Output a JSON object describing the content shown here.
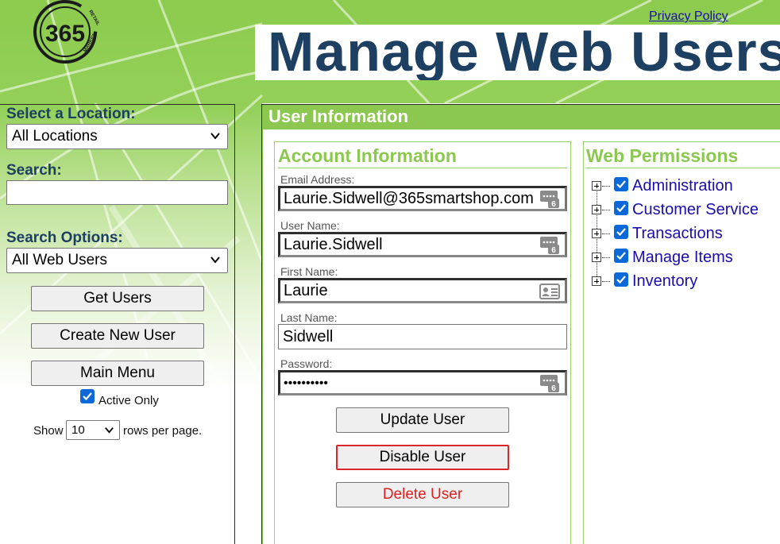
{
  "header": {
    "logo_text": "365",
    "logo_ring_top": "RETAIL",
    "logo_ring_bottom": "MARKETS",
    "privacy_link": "Privacy Policy",
    "page_title": "Manage Web Users"
  },
  "sidebar": {
    "location_label": "Select a Location:",
    "location_value": "All Locations",
    "search_label": "Search:",
    "search_value": "",
    "options_label": "Search Options:",
    "options_value": "All Web Users",
    "get_users": "Get Users",
    "create_user": "Create New User",
    "main_menu": "Main Menu",
    "active_only": "Active Only",
    "active_only_checked": true,
    "show_label": "Show",
    "rows_value": "10",
    "rows_suffix": "rows per page."
  },
  "main": {
    "header": "User Information",
    "account": {
      "title": "Account Information",
      "email_label": "Email Address:",
      "email_value": "Laurie.Sidwell@365smartshop.com",
      "username_label": "User Name:",
      "username_value": "Laurie.Sidwell",
      "firstname_label": "First Name:",
      "firstname_value": "Laurie",
      "lastname_label": "Last Name:",
      "lastname_value": "Sidwell",
      "password_label": "Password:",
      "password_value": "••••••••••",
      "update_button": "Update User",
      "disable_button": "Disable User",
      "delete_button": "Delete User"
    },
    "permissions": {
      "title": "Web Permissions",
      "items": [
        {
          "label": "Administration",
          "checked": true
        },
        {
          "label": "Customer Service",
          "checked": true
        },
        {
          "label": "Transactions",
          "checked": true
        },
        {
          "label": "Manage Items",
          "checked": true
        },
        {
          "label": "Inventory",
          "checked": true
        }
      ]
    }
  },
  "colors": {
    "brand_green": "#8cc850",
    "title_navy": "#1d3f61",
    "link_blue": "#1a0dab",
    "danger_red": "#e02020",
    "highlight_border": "#d9262c"
  }
}
